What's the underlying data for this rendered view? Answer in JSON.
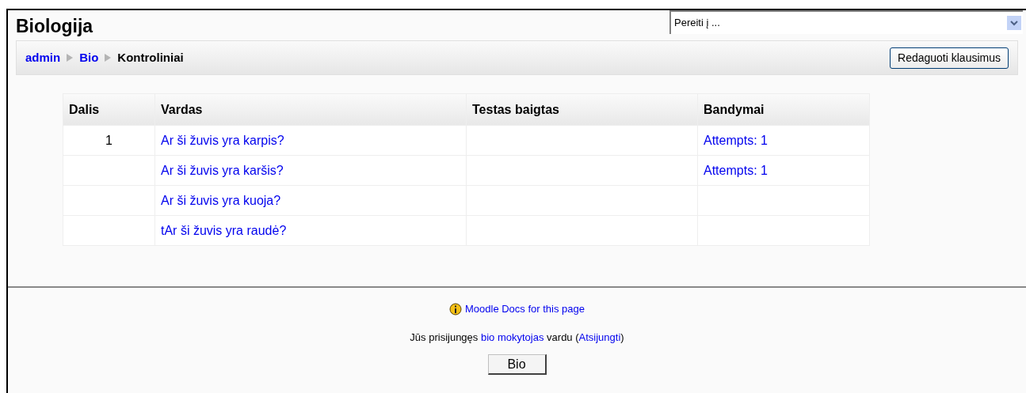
{
  "header": {
    "title": "Biologija",
    "jump_select": {
      "value": "Pereiti į ..."
    }
  },
  "breadcrumb": [
    {
      "label": "admin",
      "kind": "link"
    },
    {
      "label": "Bio",
      "kind": "link"
    },
    {
      "label": "Kontroliniai",
      "kind": "current"
    }
  ],
  "edit_button": "Redaguoti klausimus",
  "table": {
    "columns": [
      "Dalis",
      "Vardas",
      "Testas baigtas",
      "Bandymai"
    ],
    "rows": [
      {
        "section": "1",
        "name": "Ar ši žuvis yra karpis?",
        "attempts": "Attempts: 1"
      },
      {
        "name": "Ar ši žuvis yra karšis?",
        "attempts": "Attempts: 1"
      },
      {
        "name": "Ar ši žuvis yra kuoja?"
      },
      {
        "name": "tAr ši žuvis yra raudė?"
      }
    ]
  },
  "footer": {
    "docs_link": "Moodle Docs for this page",
    "login": {
      "prefix": "Jūs prisijungęs",
      "user": "bio mokytojas",
      "middle": "vardu (",
      "logout": "Atsijungti",
      "suffix": ")"
    },
    "home_button": "Bio"
  }
}
